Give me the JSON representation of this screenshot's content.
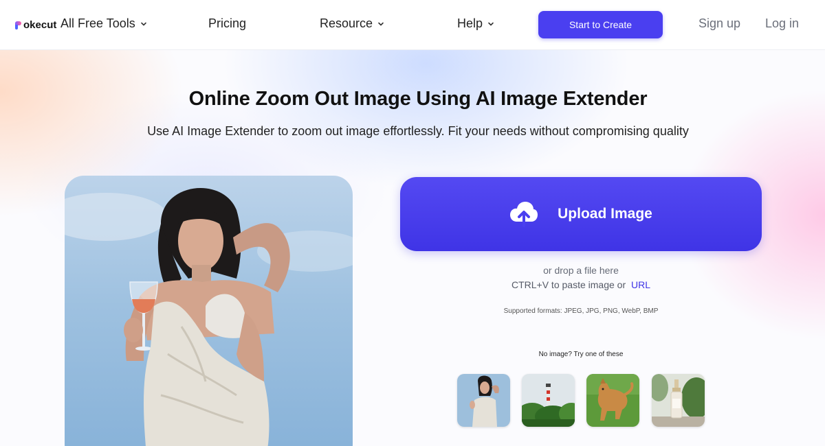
{
  "header": {
    "logo_text": "okecut",
    "nav": [
      {
        "label": "All Free Tools",
        "has_dropdown": true
      },
      {
        "label": "Pricing",
        "has_dropdown": false
      },
      {
        "label": "Resource",
        "has_dropdown": true
      },
      {
        "label": "Help",
        "has_dropdown": true
      }
    ],
    "cta_label": "Start to Create",
    "signup_label": "Sign up",
    "login_label": "Log in"
  },
  "hero": {
    "title": "Online Zoom Out Image Using AI Image Extender",
    "subtitle": "Use AI Image Extender to zoom out image effortlessly. Fit your needs without compromising quality"
  },
  "upload": {
    "button_label": "Upload Image",
    "icon": "cloud-upload-icon",
    "drop_text": "or drop a file here",
    "paste_text": "CTRL+V to paste image or",
    "url_label": "URL",
    "formats_text": "Supported formats: JPEG, JPG, PNG, WebP, BMP",
    "samples_prompt": "No image? Try one of these"
  },
  "samples": [
    {
      "name": "woman-with-wine"
    },
    {
      "name": "lighthouse"
    },
    {
      "name": "dog"
    },
    {
      "name": "serum-bottle"
    }
  ],
  "colors": {
    "accent": "#4a3ff0",
    "link": "#3f34e6"
  }
}
